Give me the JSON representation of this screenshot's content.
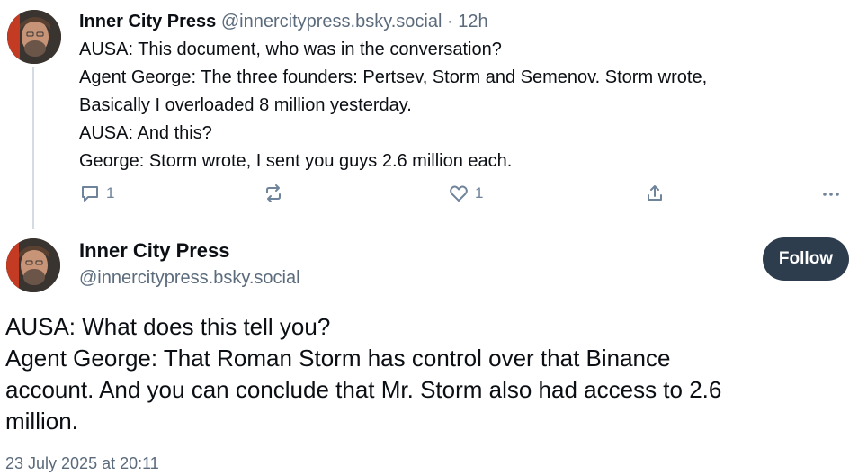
{
  "post1": {
    "author": "Inner City Press",
    "handle": "@innercitypress.bsky.social",
    "separator": "·",
    "time": "12h",
    "lines": [
      "AUSA: This document, who was in the conversation?",
      "Agent George: The three founders: Pertsev, Storm and Semenov. Storm wrote,",
      "Basically I overloaded 8 million yesterday.",
      "AUSA: And this?",
      "George: Storm wrote, I sent you guys 2.6 million each."
    ],
    "reply_count": "1",
    "like_count": "1",
    "icons": {
      "reply": "speech-bubble-icon",
      "repost": "repost-arrows-icon",
      "like": "heart-icon",
      "share": "share-upload-icon",
      "more": "ellipsis-icon"
    }
  },
  "post2": {
    "author": "Inner City Press",
    "handle": "@innercitypress.bsky.social",
    "follow_label": "Follow",
    "lines": [
      "AUSA: What does this tell you?",
      "Agent George: That Roman Storm has control over that Binance",
      "account. And you can conclude that Mr. Storm also had access to 2.6",
      "million."
    ],
    "timestamp": "23 July 2025 at 20:11"
  },
  "colors": {
    "text": "#0b0f14",
    "muted": "#5b6b7c",
    "icon": "#6f839a",
    "follow_bg": "#2e3d4d",
    "thread_line": "#d4dbe2"
  }
}
